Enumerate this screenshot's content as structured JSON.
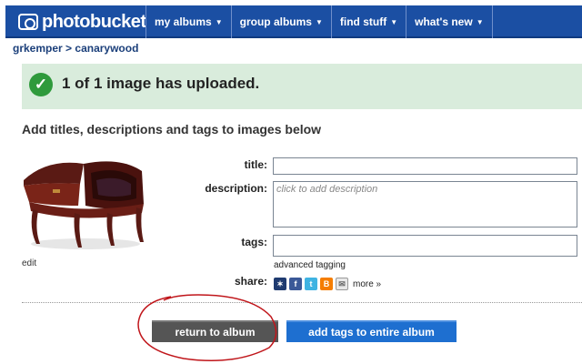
{
  "header": {
    "logo_text": "photobucket",
    "nav": [
      {
        "label": "my albums"
      },
      {
        "label": "group albums"
      },
      {
        "label": "find stuff"
      },
      {
        "label": "what's new"
      }
    ]
  },
  "breadcrumb": {
    "user": "grkemper",
    "separator": ">",
    "album": "canarywood"
  },
  "banner": {
    "message": "1 of 1 image has uploaded."
  },
  "instructions": "Add titles, descriptions and tags to images below",
  "image": {
    "edit_label": "edit"
  },
  "form": {
    "title_label": "title:",
    "title_value": "",
    "description_label": "description:",
    "description_placeholder": "click to add description",
    "tags_label": "tags:",
    "tags_value": "",
    "advanced_tagging": "advanced tagging",
    "share_label": "share:",
    "share_icons": [
      "myspace-icon",
      "facebook-icon",
      "twitter-icon",
      "blogger-icon",
      "email-icon"
    ],
    "more_label": "more »"
  },
  "buttons": {
    "return": "return to album",
    "add_tags": "add tags to entire album"
  },
  "colors": {
    "nav_bg": "#1b4fa3",
    "banner_bg": "#d9ecdc",
    "check_green": "#2f9a3c",
    "return_btn": "#555555",
    "tags_btn": "#1e6fd0",
    "annotation": "#c0161b"
  }
}
